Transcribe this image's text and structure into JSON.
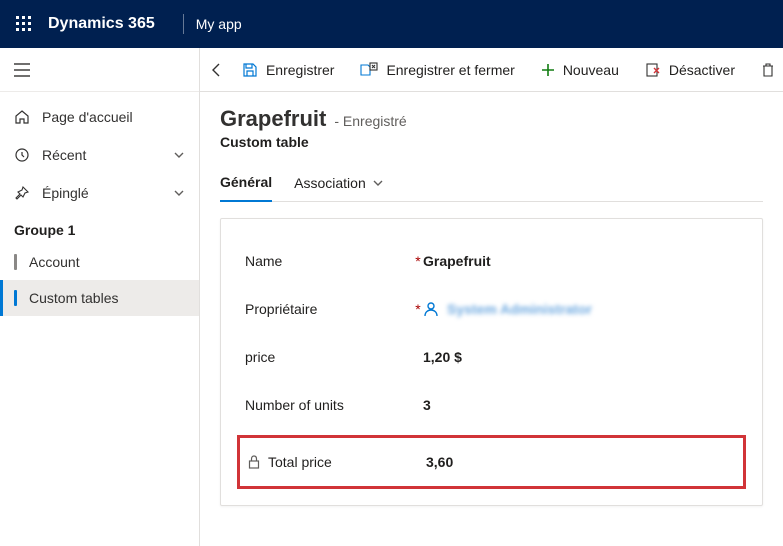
{
  "topbar": {
    "brand": "Dynamics 365",
    "app": "My app"
  },
  "sidebar": {
    "home": "Page d'accueil",
    "recent": "Récent",
    "pinned": "Épinglé",
    "group1": "Groupe 1",
    "account": "Account",
    "custom_tables": "Custom tables"
  },
  "cmd": {
    "save": "Enregistrer",
    "save_close": "Enregistrer et fermer",
    "new": "Nouveau",
    "deactivate": "Désactiver"
  },
  "page": {
    "title": "Grapefruit",
    "status": "- Enregistré",
    "subtitle": "Custom table"
  },
  "tabs": {
    "general": "Général",
    "association": "Association"
  },
  "form": {
    "name_label": "Name",
    "name_value": "Grapefruit",
    "owner_label": "Propriétaire",
    "owner_value": "System Administrator",
    "price_label": "price",
    "price_value": "1,20 $",
    "units_label": "Number of units",
    "units_value": "3",
    "total_label": "Total price",
    "total_value": "3,60"
  }
}
